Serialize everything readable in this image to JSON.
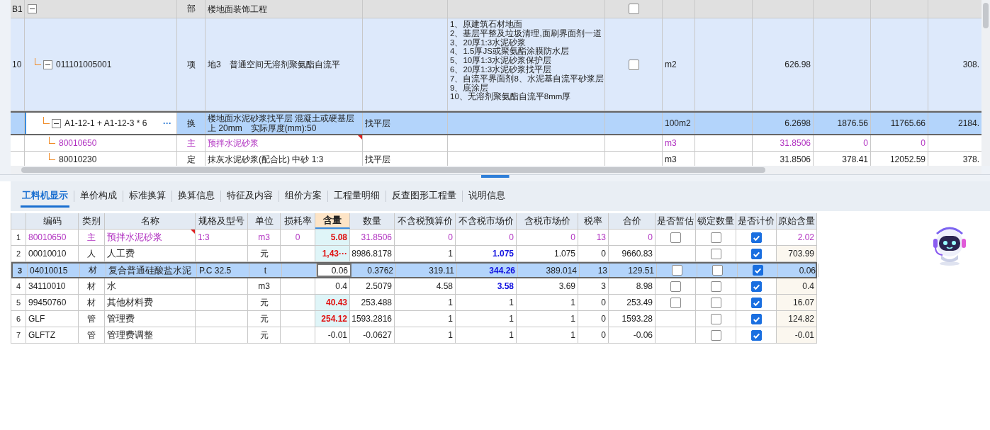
{
  "bill_grid": {
    "rows": [
      {
        "number": "B1",
        "kind": "section",
        "selected": false,
        "expanded": true,
        "type": "部",
        "name": "楼地面装饰工程",
        "checked": false,
        "children": [
          {
            "number": "10",
            "kind": "item",
            "selected": false,
            "expanded": true,
            "code": "011101005001",
            "type": "项",
            "name": "地3　普通空间无溶剂聚氨酯自流平",
            "column_6": "1、原建筑石材地面\n2、基层平整及垃圾清理,面刷界面剂一道\n3、20厚1:3水泥砂浆\n4、1.5厚JS或聚氨酯涂膜防水层\n5、10厚1:3水泥砂浆保护层\n6、20厚1:3水泥砂浆找平层\n7、自流平界面剂8、水泥基自流平砂浆层\n9、底涂层\n10、无溶剂聚氨酯自流平8mm厚",
            "checked": false,
            "unit": "m2",
            "column_10": "626.98",
            "column_13": "308.",
            "children": [
              {
                "kind": "sub",
                "selected": true,
                "expanded": true,
                "code": "A1-12-1 + A1-12-3 * 6",
                "action_label": "···",
                "type": "换",
                "name": "楼地面水泥砂浆找平层 混凝土或硬基层上 20mm　实际厚度(mm):50",
                "column_5": "找平层",
                "unit": "100m2",
                "column_10": "6.2698",
                "column_11": "1876.56",
                "column_12": "11765.66",
                "column_13": "2184.",
                "children": [
                  {
                    "kind": "main",
                    "selected": false,
                    "code": "80010650",
                    "type": "主",
                    "name": "预拌水泥砂浆",
                    "marked": true,
                    "unit": "m3",
                    "column_10": "31.8506",
                    "column_11": "0",
                    "column_12": "0"
                  },
                  {
                    "kind": "normal",
                    "selected": false,
                    "code": "80010230",
                    "type": "定",
                    "name": "抹灰水泥砂浆(配合比) 中砂 1:3",
                    "column_5": "找平层",
                    "unit": "m3",
                    "column_10": "31.8506",
                    "column_11": "378.41",
                    "column_12": "12052.59",
                    "column_13": "378."
                  }
                ]
              }
            ]
          }
        ]
      }
    ]
  },
  "tabs": [
    {
      "label": "工料机显示",
      "selected": true
    },
    {
      "label": "单价构成",
      "selected": false
    },
    {
      "label": "标准换算",
      "selected": false
    },
    {
      "label": "换算信息",
      "selected": false
    },
    {
      "label": "特征及内容",
      "selected": false
    },
    {
      "label": "组价方案",
      "selected": false
    },
    {
      "label": "工程量明细",
      "selected": false
    },
    {
      "label": "反查图形工程量",
      "selected": false
    },
    {
      "label": "说明信息",
      "selected": false
    }
  ],
  "resource_table": {
    "columns": [
      {
        "label": "编码",
        "selected": false
      },
      {
        "label": "类别",
        "selected": false
      },
      {
        "label": "名称",
        "selected": false
      },
      {
        "label": "规格及型号",
        "selected": false
      },
      {
        "label": "单位",
        "selected": false
      },
      {
        "label": "损耗率",
        "selected": false
      },
      {
        "label": "含量",
        "selected": true
      },
      {
        "label": "数量",
        "selected": false
      },
      {
        "label": "不含税预算价",
        "selected": false
      },
      {
        "label": "不含税市场价",
        "selected": false
      },
      {
        "label": "含税市场价",
        "selected": false
      },
      {
        "label": "税率",
        "selected": false
      },
      {
        "label": "合价",
        "selected": false
      },
      {
        "label": "是否暂估",
        "selected": false
      },
      {
        "label": "锁定数量",
        "selected": false
      },
      {
        "label": "是否计价",
        "selected": false
      },
      {
        "label": "原始含量",
        "selected": false
      }
    ],
    "rows": [
      {
        "number": "1",
        "kind": "main",
        "selected": false,
        "code": "80010650",
        "category": "主",
        "name": "预拌水泥砂浆",
        "marked": true,
        "spec": "1:3",
        "unit": "m3",
        "loss_rate": "0",
        "content": "5.08",
        "content_changed": true,
        "quantity": "31.8506",
        "budget_price": "0",
        "market_price": "0",
        "price_changed": false,
        "tax_market_price": "0",
        "tax_rate": "13",
        "total": "0",
        "provisional": {
          "checked": false
        },
        "locked": false,
        "priced": true,
        "original_content": "2.02"
      },
      {
        "number": "2",
        "kind": "normal",
        "selected": false,
        "code": "00010010",
        "category": "人",
        "name": "人工费",
        "unit": "元",
        "content": "1,43···",
        "content_changed": true,
        "quantity": "8986.8178",
        "budget_price": "1",
        "market_price": "1.075",
        "price_changed": true,
        "tax_market_price": "1.075",
        "tax_rate": "0",
        "total": "9660.83",
        "locked": false,
        "priced": true,
        "original_content": "703.99"
      },
      {
        "number": "3",
        "kind": "normal",
        "selected": true,
        "code": "04010015",
        "category": "材",
        "name": "复合普通硅酸盐水泥",
        "spec": "P.C 32.5",
        "unit": "t",
        "content": "0.06",
        "content_changed": false,
        "quantity": "0.3762",
        "budget_price": "319.11",
        "market_price": "344.26",
        "price_changed": true,
        "tax_market_price": "389.014",
        "tax_rate": "13",
        "total": "129.51",
        "provisional": {
          "checked": false
        },
        "locked": false,
        "priced": true,
        "original_content": "0.06"
      },
      {
        "number": "4",
        "kind": "normal",
        "selected": false,
        "code": "34110010",
        "category": "材",
        "name": "水",
        "unit": "m3",
        "content": "0.4",
        "content_changed": false,
        "quantity": "2.5079",
        "budget_price": "4.58",
        "market_price": "3.58",
        "price_changed": true,
        "tax_market_price": "3.69",
        "tax_rate": "3",
        "total": "8.98",
        "provisional": {
          "checked": false
        },
        "locked": false,
        "priced": true,
        "original_content": "0.4"
      },
      {
        "number": "5",
        "kind": "normal",
        "selected": false,
        "code": "99450760",
        "category": "材",
        "name": "其他材料费",
        "unit": "元",
        "content": "40.43",
        "content_changed": true,
        "quantity": "253.488",
        "budget_price": "1",
        "market_price": "1",
        "price_changed": false,
        "tax_market_price": "1",
        "tax_rate": "0",
        "total": "253.49",
        "provisional": {
          "checked": false
        },
        "locked": false,
        "priced": true,
        "original_content": "16.07"
      },
      {
        "number": "6",
        "kind": "normal",
        "selected": false,
        "code": "GLF",
        "category": "管",
        "name": "管理费",
        "unit": "元",
        "content": "254.12",
        "content_changed": true,
        "quantity": "1593.2816",
        "budget_price": "1",
        "market_price": "1",
        "price_changed": false,
        "tax_market_price": "1",
        "tax_rate": "0",
        "total": "1593.28",
        "locked": false,
        "priced": true,
        "original_content": "124.82"
      },
      {
        "number": "7",
        "kind": "normal",
        "selected": false,
        "code": "GLFTZ",
        "category": "管",
        "name": "管理费调整",
        "unit": "元",
        "content": "-0.01",
        "content_changed": false,
        "quantity": "-0.0627",
        "budget_price": "1",
        "market_price": "1",
        "price_changed": false,
        "tax_market_price": "1",
        "tax_rate": "0",
        "total": "-0.06",
        "locked": false,
        "priced": true,
        "original_content": "-0.01"
      }
    ]
  }
}
